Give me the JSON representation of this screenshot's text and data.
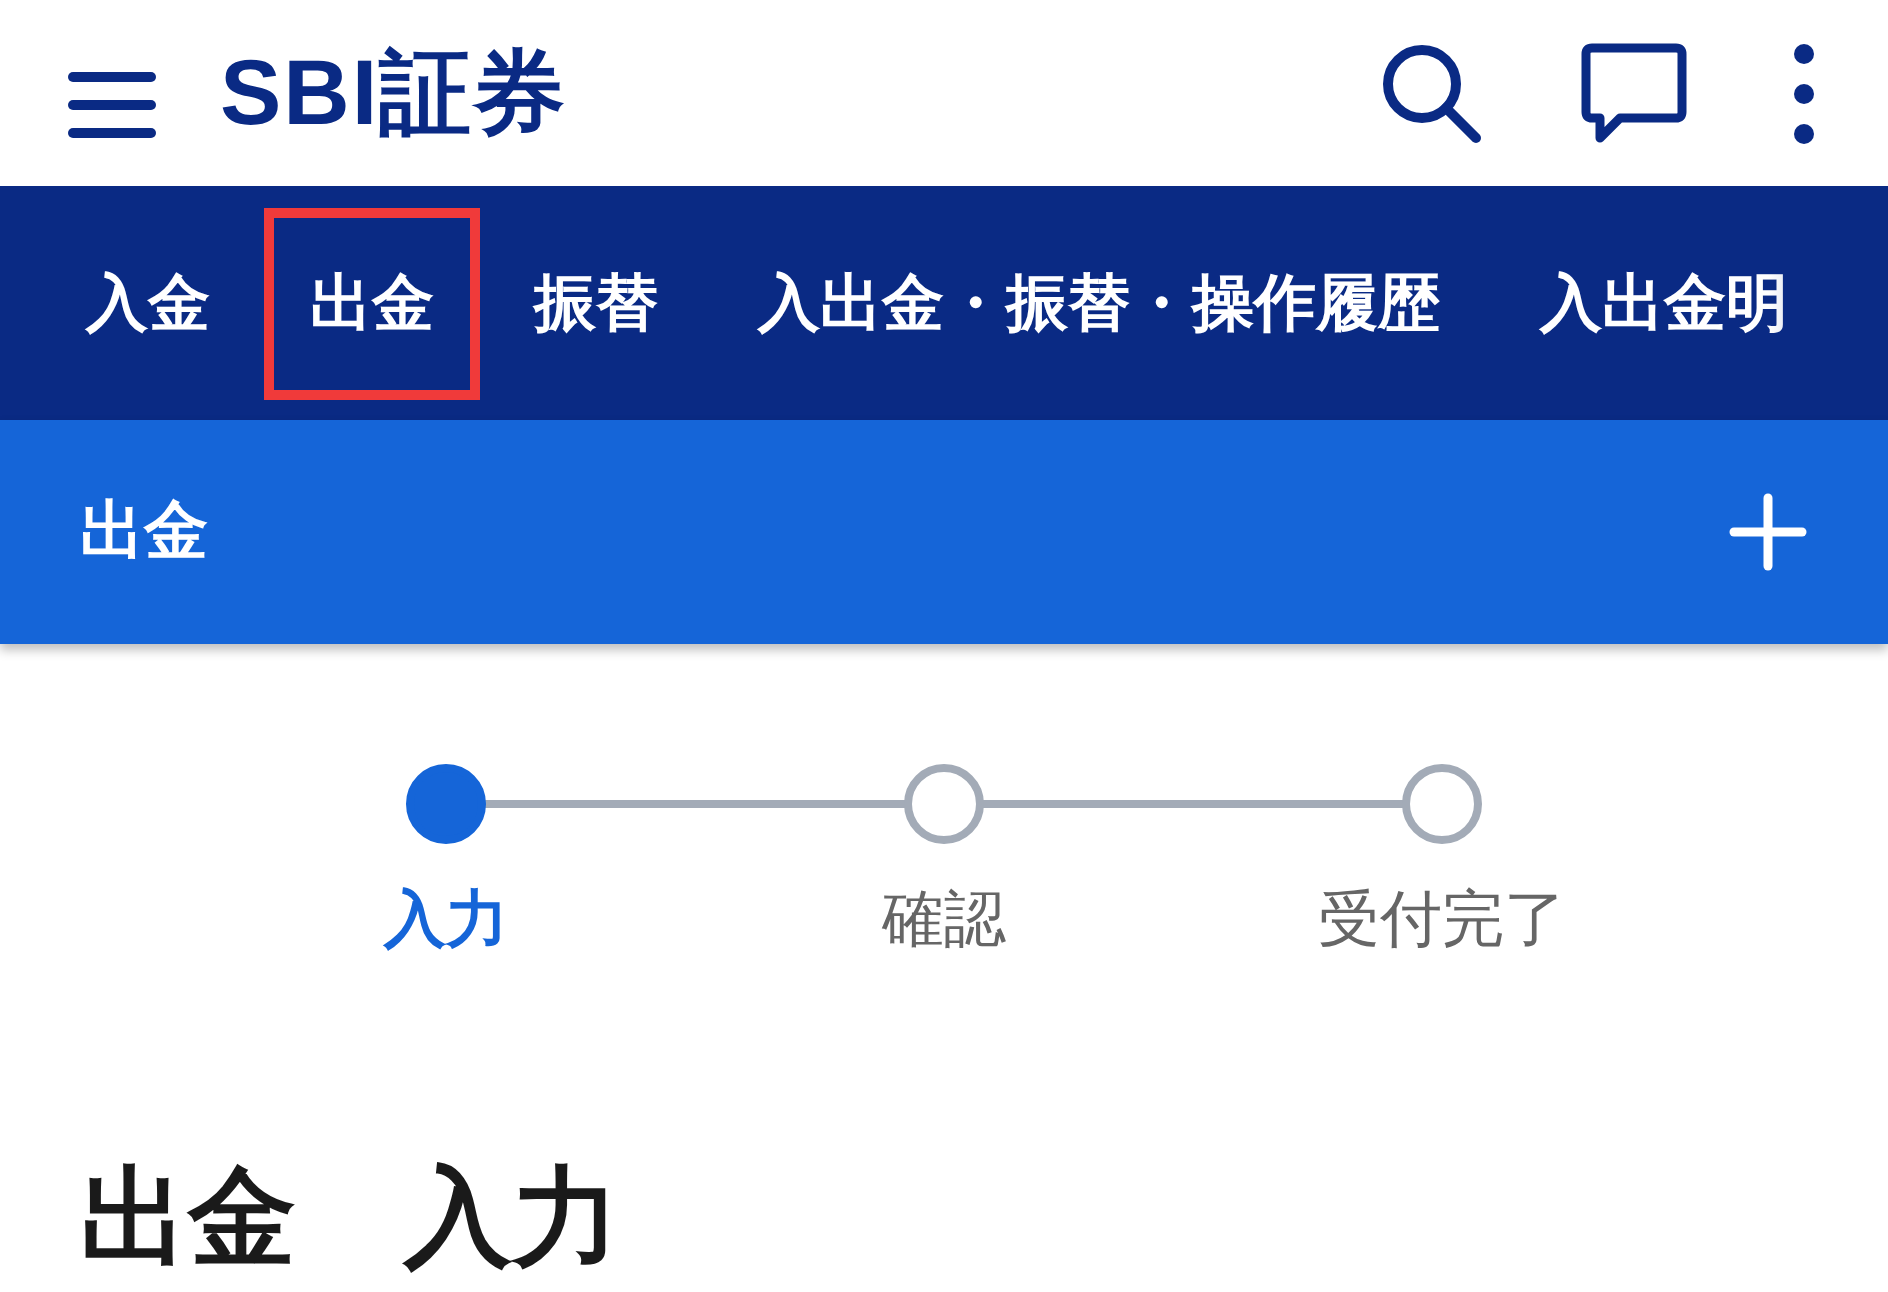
{
  "header": {
    "logo": "SBI証券"
  },
  "tabs": [
    {
      "label": "入金",
      "highlighted": false
    },
    {
      "label": "出金",
      "highlighted": true
    },
    {
      "label": "振替",
      "highlighted": false
    },
    {
      "label": "入出金・振替・操作履歴",
      "highlighted": false
    },
    {
      "label": "入出金明",
      "highlighted": false
    }
  ],
  "section": {
    "title": "出金",
    "expanded": false
  },
  "steps": [
    {
      "label": "入力",
      "selected": true
    },
    {
      "label": "確認",
      "selected": false
    },
    {
      "label": "受付完了",
      "selected": false
    }
  ],
  "heading": "出金　入力"
}
